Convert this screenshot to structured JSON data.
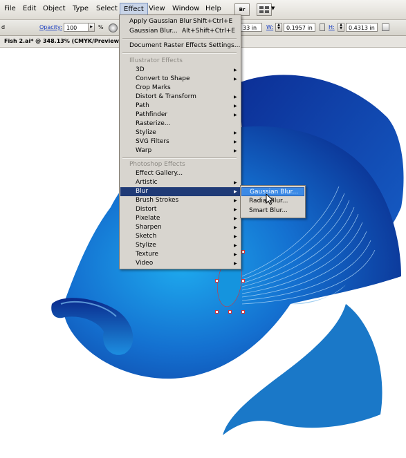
{
  "menubar": {
    "items": [
      "File",
      "Edit",
      "Object",
      "Type",
      "Select",
      "Effect",
      "View",
      "Window",
      "Help"
    ],
    "bridge_label": "Br"
  },
  "controlbar": {
    "left_label": "d",
    "opacity_label": "Opacity:",
    "opacity_value": "100",
    "percent": "%",
    "x_value": "33 in",
    "w_label": "W:",
    "w_value": "0.1957 in",
    "h_label": "H:",
    "h_value": "0.4313 in"
  },
  "document": {
    "tab_title": "Fish 2.ai* @ 348.13% (CMYK/Preview)"
  },
  "effect_menu": {
    "top": [
      {
        "label": "Apply Gaussian Blur",
        "shortcut": "Shift+Ctrl+E"
      },
      {
        "label": "Gaussian Blur...",
        "shortcut": "Alt+Shift+Ctrl+E"
      }
    ],
    "document_raster": "Document Raster Effects Settings...",
    "illustrator_header": "Illustrator Effects",
    "illustrator_items": [
      "3D",
      "Convert to Shape",
      "Crop Marks",
      "Distort & Transform",
      "Path",
      "Pathfinder",
      "Rasterize...",
      "Stylize",
      "SVG Filters",
      "Warp"
    ],
    "photoshop_header": "Photoshop Effects",
    "photoshop_items": [
      "Effect Gallery...",
      "Artistic",
      "Blur",
      "Brush Strokes",
      "Distort",
      "Pixelate",
      "Sharpen",
      "Sketch",
      "Stylize",
      "Texture",
      "Video"
    ]
  },
  "blur_submenu": {
    "items": [
      "Gaussian Blur...",
      "Radial Blur...",
      "Smart Blur..."
    ]
  },
  "colors": {
    "fish_dark": "#0a2a8c",
    "fish_mid": "#0f5fc4",
    "fish_light": "#1aa0e6",
    "tail": "#1a78c8",
    "menu_bg": "#d8d5cf",
    "menu_highlight": "#1f3a76",
    "submenu_highlight": "#3b8ae6"
  }
}
